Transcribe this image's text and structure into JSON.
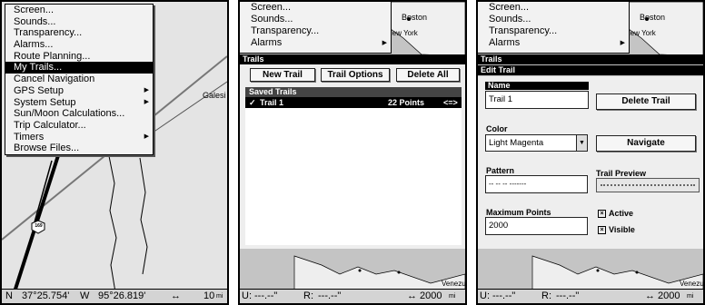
{
  "panel1": {
    "menu": [
      {
        "label": "Screen...",
        "submenu": false
      },
      {
        "label": "Sounds...",
        "submenu": false
      },
      {
        "label": "Transparency...",
        "submenu": false
      },
      {
        "label": "Alarms...",
        "submenu": false
      },
      {
        "label": "Route Planning...",
        "submenu": false
      },
      {
        "label": "My Trails...",
        "submenu": false,
        "selected": true
      },
      {
        "label": "Cancel Navigation",
        "submenu": false
      },
      {
        "label": "GPS Setup",
        "submenu": true
      },
      {
        "label": "System Setup",
        "submenu": true
      },
      {
        "label": "Sun/Moon Calculations...",
        "submenu": false
      },
      {
        "label": "Trip Calculator...",
        "submenu": false
      },
      {
        "label": "Timers",
        "submenu": true
      },
      {
        "label": "Browse Files...",
        "submenu": false
      }
    ],
    "map_label": "Galesi",
    "route_shield": "169",
    "status": {
      "lat_prefix": "N",
      "lat": "37°25.754'",
      "lon_prefix": "W",
      "lon": "95°26.819'",
      "scale_icon": "↔",
      "scale": "10",
      "unit": "mi"
    }
  },
  "top_menu": {
    "items": [
      {
        "label": "Screen..."
      },
      {
        "label": "Sounds..."
      },
      {
        "label": "Transparency..."
      },
      {
        "label": "Alarms",
        "submenu": true
      }
    ],
    "map_boston": "Boston",
    "map_newyork": "New York",
    "map_venezuela": "Venezu"
  },
  "panel2": {
    "header": "Trails",
    "buttons": {
      "new_trail": "New Trail",
      "trail_options": "Trail Options",
      "delete_all": "Delete All"
    },
    "saved_header": "Saved Trails",
    "trail": {
      "check": "✓",
      "name": "Trail 1",
      "points": "22 Points",
      "icon": "<=>"
    },
    "status": {
      "u_label": "U:",
      "u_value": "---.--\"",
      "r_label": "R:",
      "r_value": "---.--\"",
      "scale_icon": "↔",
      "scale": "2000",
      "unit": "mi"
    }
  },
  "panel3": {
    "header1": "Trails",
    "header2": "Edit Trail",
    "name_label": "Name",
    "name_value": "Trail 1",
    "delete_button": "Delete Trail",
    "color_label": "Color",
    "color_value": "Light Magenta",
    "navigate_button": "Navigate",
    "pattern_label": "Pattern",
    "pattern_value": "-- -- -- -------",
    "preview_label": "Trail Preview",
    "max_label": "Maximum Points",
    "max_value": "2000",
    "active_label": "Active",
    "visible_label": "Visible",
    "check_mark": "×",
    "status": {
      "u_label": "U:",
      "u_value": "---.--\"",
      "r_label": "R:",
      "r_value": "---.--\"",
      "scale_icon": "↔",
      "scale": "2000",
      "unit": "mi"
    }
  },
  "colors": {
    "selection": "#000000",
    "menu_bg": "#f2f2f2",
    "trail_magenta": "#b0306f"
  }
}
